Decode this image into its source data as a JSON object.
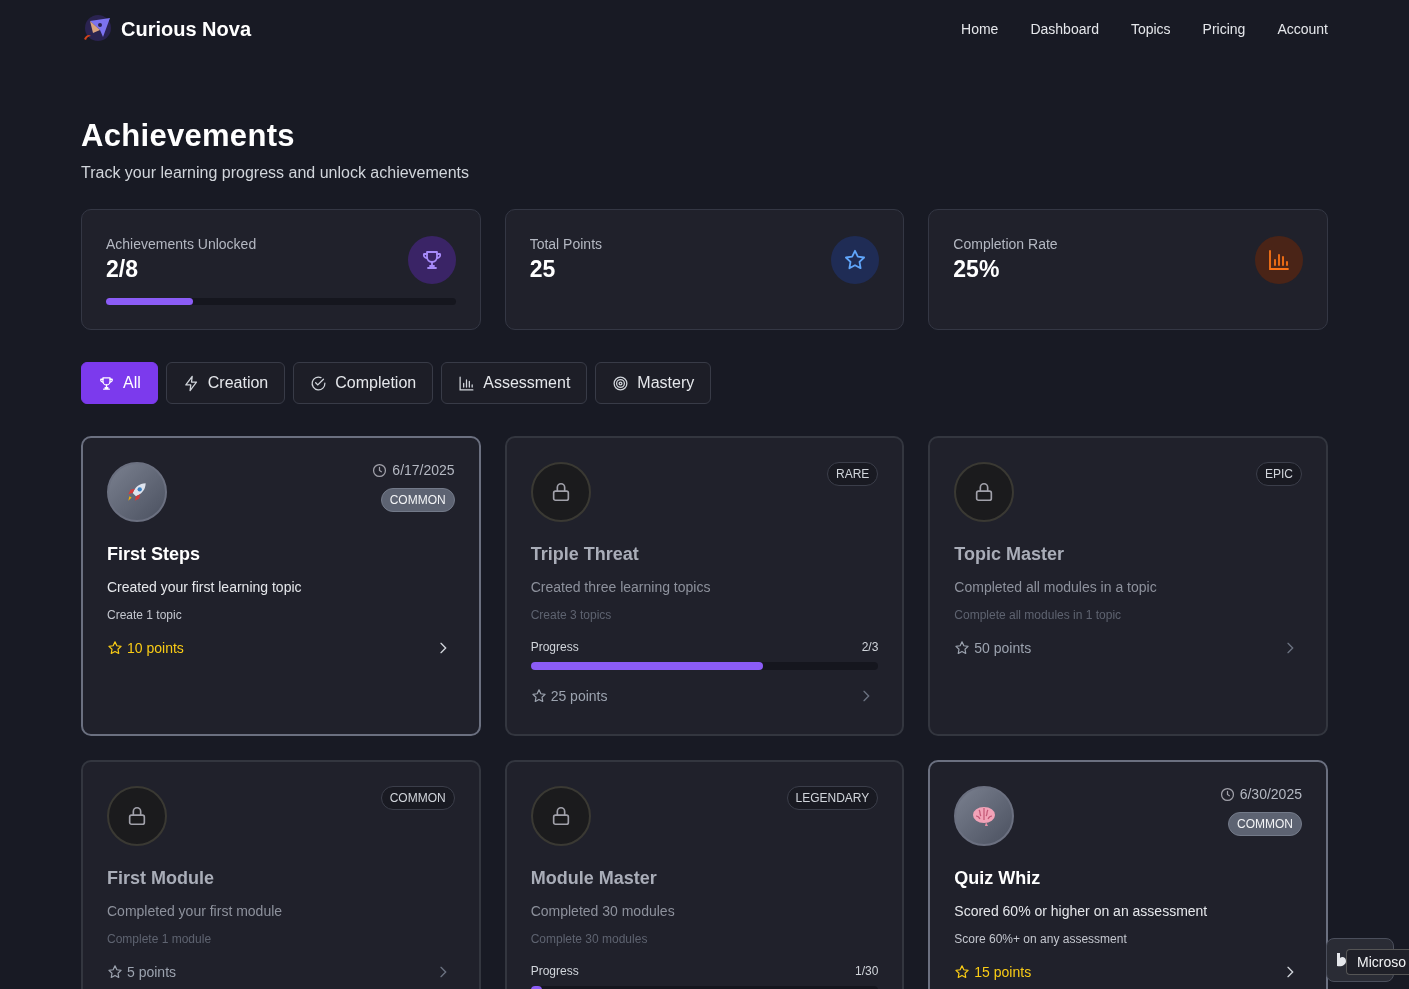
{
  "brand": {
    "name": "Curious Nova"
  },
  "nav": [
    "Home",
    "Dashboard",
    "Topics",
    "Pricing",
    "Account"
  ],
  "header": {
    "title": "Achievements",
    "subtitle": "Track your learning progress and unlock achievements"
  },
  "stats": [
    {
      "kind": "trophy",
      "label": "Achievements Unlocked",
      "value": "2/8",
      "level": 0.25
    },
    {
      "kind": "star",
      "label": "Total Points",
      "value": "25"
    },
    {
      "kind": "chart",
      "label": "Completion Rate",
      "value": "25%"
    }
  ],
  "filters": [
    {
      "kind": "trophy",
      "label": "All",
      "selected": true
    },
    {
      "kind": "bolt",
      "label": "Creation",
      "selected": false
    },
    {
      "kind": "check",
      "label": "Completion",
      "selected": false
    },
    {
      "kind": "chart",
      "label": "Assessment",
      "selected": false
    },
    {
      "kind": "target",
      "label": "Mastery",
      "selected": false
    }
  ],
  "achievements": [
    {
      "kind": "rocket",
      "unlocked": true,
      "date": "6/17/2025",
      "rarity": "COMMON",
      "title": "First Steps",
      "description": "Created your first learning topic",
      "requirement": "Create 1 topic",
      "points": "10 points"
    },
    {
      "kind": "lock",
      "unlocked": false,
      "rarity": "RARE",
      "title": "Triple Threat",
      "description": "Created three learning topics",
      "requirement": "Create 3 topics",
      "progress": {
        "label": "Progress",
        "reading": "2/3",
        "level": 0.667
      },
      "points": "25 points"
    },
    {
      "kind": "lock",
      "unlocked": false,
      "rarity": "EPIC",
      "title": "Topic Master",
      "description": "Completed all modules in a topic",
      "requirement": "Complete all modules in 1 topic",
      "points": "50 points"
    },
    {
      "kind": "lock",
      "unlocked": false,
      "rarity": "COMMON",
      "title": "First Module",
      "description": "Completed your first module",
      "requirement": "Complete 1 module",
      "points": "5 points"
    },
    {
      "kind": "lock",
      "unlocked": false,
      "rarity": "LEGENDARY",
      "title": "Module Master",
      "description": "Completed 30 modules",
      "requirement": "Complete 30 modules",
      "progress": {
        "label": "Progress",
        "reading": "1/30",
        "level": 0.033
      }
    },
    {
      "kind": "brain",
      "unlocked": true,
      "date": "6/30/2025",
      "rarity": "COMMON",
      "title": "Quiz Whiz",
      "description": "Scored 60% or higher on an assessment",
      "requirement": "Score 60%+ on any assessment",
      "points": "15 points"
    }
  ],
  "tooltip": {
    "text": "Microso"
  }
}
